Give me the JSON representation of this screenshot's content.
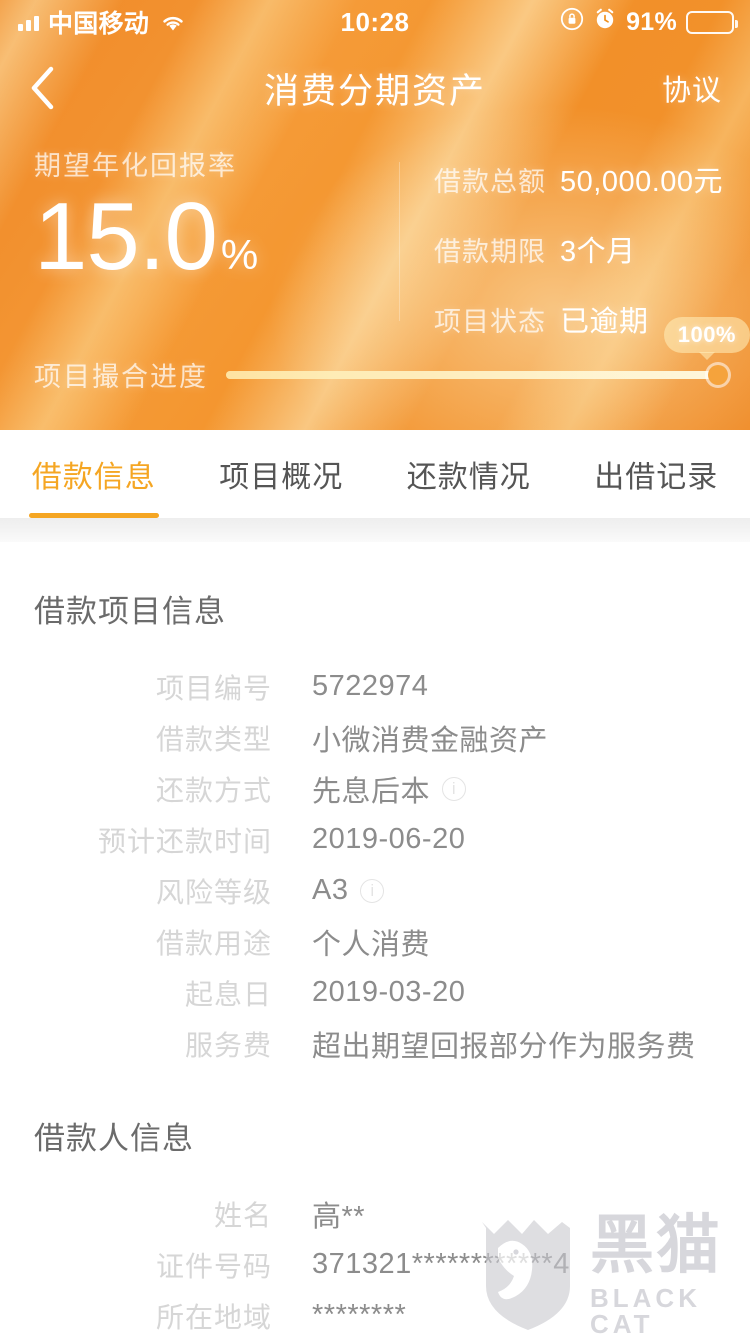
{
  "statusbar": {
    "carrier": "中国移动",
    "time": "10:28",
    "battery_percent": "91%",
    "signal_icon": "signal-bars-icon",
    "wifi_icon": "wifi-icon",
    "rotation_lock_icon": "rotation-lock-icon",
    "alarm_icon": "alarm-clock-icon",
    "battery_icon": "battery-icon"
  },
  "navbar": {
    "back_icon": "back-chevron-icon",
    "title": "消费分期资产",
    "right_action": "协议"
  },
  "hero": {
    "rate_label": "期望年化回报率",
    "rate_value": "15.0",
    "rate_unit": "%",
    "stats": [
      {
        "label": "借款总额",
        "value": "50,000.00元"
      },
      {
        "label": "借款期限",
        "value": "3个月"
      },
      {
        "label": "项目状态",
        "value": "已逾期"
      }
    ]
  },
  "progress": {
    "label": "项目撮合进度",
    "badge": "100%",
    "percent": 100
  },
  "tabs": [
    {
      "label": "借款信息",
      "active": true
    },
    {
      "label": "项目概况",
      "active": false
    },
    {
      "label": "还款情况",
      "active": false
    },
    {
      "label": "出借记录",
      "active": false
    }
  ],
  "sections": [
    {
      "title": "借款项目信息",
      "rows": [
        {
          "label": "项目编号",
          "value": "5722974",
          "info": false
        },
        {
          "label": "借款类型",
          "value": "小微消费金融资产",
          "info": false
        },
        {
          "label": "还款方式",
          "value": "先息后本",
          "info": true
        },
        {
          "label": "预计还款时间",
          "value": "2019-06-20",
          "info": false
        },
        {
          "label": "风险等级",
          "value": "A3",
          "info": true
        },
        {
          "label": "借款用途",
          "value": "个人消费",
          "info": false
        },
        {
          "label": "起息日",
          "value": "2019-03-20",
          "info": false
        },
        {
          "label": "服务费",
          "value": "超出期望回报部分作为服务费",
          "info": false
        }
      ]
    },
    {
      "title": "借款人信息",
      "rows": [
        {
          "label": "姓名",
          "value": "高**",
          "info": false
        },
        {
          "label": "证件号码",
          "value": "371321************4",
          "info": false
        },
        {
          "label": "所在地域",
          "value": "********",
          "info": false
        }
      ]
    }
  ],
  "watermark": {
    "cn": "黑猫",
    "en": "BLACK CAT",
    "icon": "black-cat-shield-icon"
  },
  "colors": {
    "brand_orange": "#f5a623",
    "header_orange": "#f2912f",
    "label_gray": "#d6d6d6",
    "value_gray": "#8c8c8c",
    "title_gray": "#6b6b6b"
  }
}
